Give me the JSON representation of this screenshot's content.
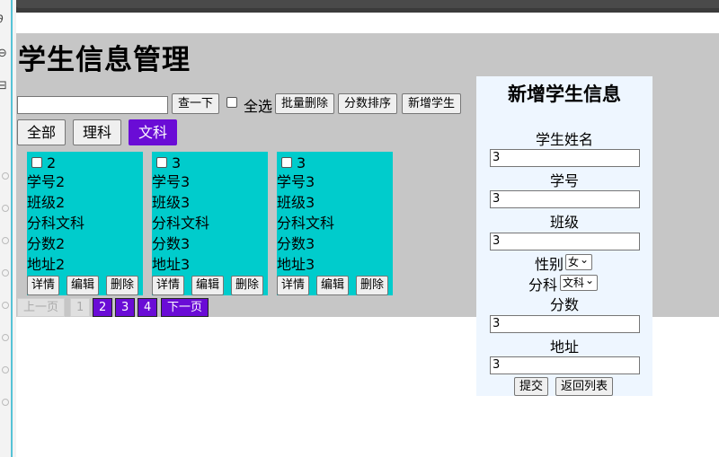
{
  "page": {
    "title": "学生信息管理"
  },
  "toolbar": {
    "search_placeholder": "",
    "search_button": "查一下",
    "select_all_label": "全选",
    "batch_delete": "批量删除",
    "sort_by_score": "分数排序",
    "add_student": "新增学生"
  },
  "filters": [
    "全部",
    "理科",
    "文科"
  ],
  "active_filter": "文科",
  "cards": [
    {
      "id": "2",
      "student_no": "学号2",
      "class": "班级2",
      "subject": "分科文科",
      "score": "分数2",
      "address": "地址2"
    },
    {
      "id": "3",
      "student_no": "学号3",
      "class": "班级3",
      "subject": "分科文科",
      "score": "分数3",
      "address": "地址3"
    },
    {
      "id": "3",
      "student_no": "学号3",
      "class": "班级3",
      "subject": "分科文科",
      "score": "分数3",
      "address": "地址3"
    }
  ],
  "card_actions": {
    "detail": "详情",
    "edit": "编辑",
    "delete": "删除"
  },
  "pagination": {
    "prev": "上一页",
    "pages": [
      "1",
      "2",
      "3",
      "4"
    ],
    "current": "1",
    "next": "下一页"
  },
  "form": {
    "title": "新增学生信息",
    "name_label": "学生姓名",
    "name_value": "3",
    "student_no_label": "学号",
    "student_no_value": "3",
    "class_label": "班级",
    "class_value": "3",
    "gender_label": "性别",
    "gender_value": "女",
    "subject_label": "分科",
    "subject_value": "文科",
    "score_label": "分数",
    "score_value": "3",
    "address_label": "地址",
    "address_value": "3",
    "submit": "提交",
    "back": "返回列表"
  },
  "colors": {
    "accent": "#6a0cd6",
    "card": "#00cccc",
    "panel": "#c6c6c6",
    "form_bg": "#eef6ff"
  }
}
